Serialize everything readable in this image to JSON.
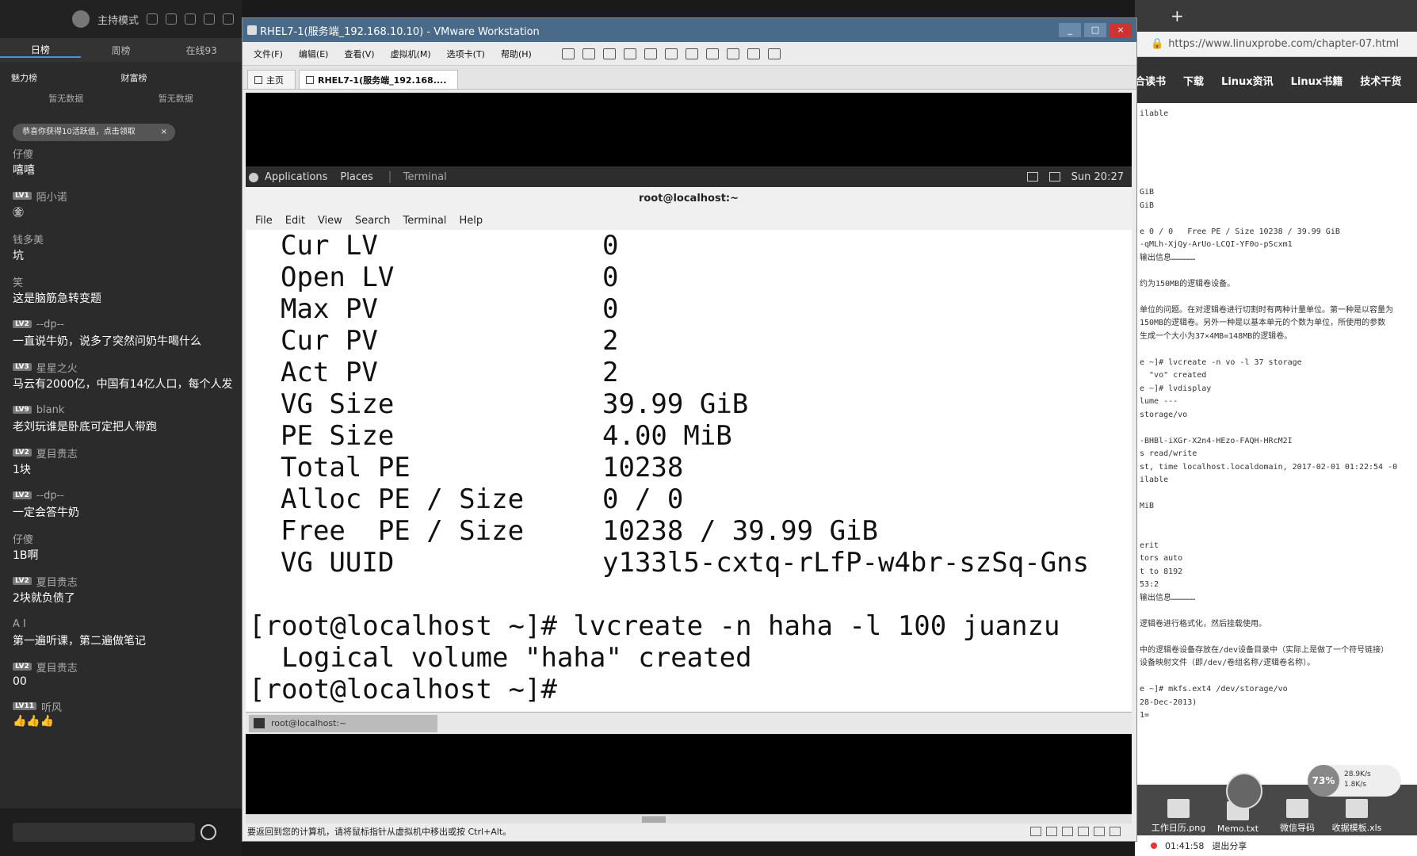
{
  "chat": {
    "host_mode": "主持模式",
    "tabs": [
      "日榜",
      "周榜",
      "在线93"
    ],
    "rank_left": "魅力榜",
    "rank_right": "财富榜",
    "rank_left_empty": "暂无数据",
    "rank_right_empty": "暂无数据",
    "notice": "恭喜你获得10活跃值，点击领取",
    "notice_close": "×",
    "messages": [
      {
        "level": "",
        "user": "仔傻",
        "text": "嘻嘻"
      },
      {
        "level": "LV1",
        "user": "陌小诺",
        "text": "㊎"
      },
      {
        "level": "",
        "user": "钱多美",
        "text": "坑"
      },
      {
        "level": "",
        "user": "笑",
        "text": "这是脑筋急转变题"
      },
      {
        "level": "LV2",
        "user": "--dp--",
        "text": "一直说牛奶，说多了突然问奶牛喝什么"
      },
      {
        "level": "LV3",
        "user": "星星之火",
        "text": "马云有2000亿，中国有14亿人口，每个人发"
      },
      {
        "level": "LV9",
        "user": "blank",
        "text": "老刘玩谁是卧底可定把人带跑"
      },
      {
        "level": "LV2",
        "user": "夏目贵志",
        "text": "1块"
      },
      {
        "level": "LV2",
        "user": "--dp--",
        "text": "一定会答牛奶"
      },
      {
        "level": "",
        "user": "仔傻",
        "text": "1B啊"
      },
      {
        "level": "LV2",
        "user": "夏目贵志",
        "text": "2块就负债了"
      },
      {
        "level": "",
        "user": "A  I",
        "text": "第一遍听课，第二遍做笔记"
      },
      {
        "level": "LV2",
        "user": "夏目贵志",
        "text": "00"
      },
      {
        "level": "LV11",
        "user": "听风",
        "text": "👍👍👍"
      }
    ]
  },
  "vmware": {
    "title": "RHEL7-1(服务端_192.168.10.10) - VMware Workstation",
    "menu": [
      "文件(F)",
      "编辑(E)",
      "查看(V)",
      "虚拟机(M)",
      "选项卡(T)",
      "帮助(H)"
    ],
    "tabs": [
      "主页",
      "RHEL7-1(服务端_192.168...."
    ],
    "status": "要返回到您的计算机，请将鼠标指针从虚拟机中移出或按 Ctrl+Alt。"
  },
  "gnome": {
    "applications": "Applications",
    "places": "Places",
    "terminal": "Terminal",
    "clock": "Sun 20:27",
    "task_label": "root@localhost:~"
  },
  "terminal": {
    "title": "root@localhost:~",
    "menu": [
      "File",
      "Edit",
      "View",
      "Search",
      "Terminal",
      "Help"
    ],
    "vg_rows": [
      {
        "k": "Cur LV",
        "v": "0"
      },
      {
        "k": "Open LV",
        "v": "0"
      },
      {
        "k": "Max PV",
        "v": "0"
      },
      {
        "k": "Cur PV",
        "v": "2"
      },
      {
        "k": "Act PV",
        "v": "2"
      },
      {
        "k": "VG Size",
        "v": "39.99 GiB"
      },
      {
        "k": "PE Size",
        "v": "4.00 MiB"
      },
      {
        "k": "Total PE",
        "v": "10238"
      },
      {
        "k": "Alloc PE / Size",
        "v": "0 / 0"
      },
      {
        "k": "Free  PE / Size",
        "v": "10238 / 39.99 GiB"
      },
      {
        "k": "VG UUID",
        "v": "y133l5-cxtq-rLfP-w4br-szSq-Gns"
      }
    ],
    "command": "[root@localhost ~]# lvcreate -n haha -l 100 juanzu",
    "output": "  Logical volume \"haha\" created",
    "prompt": "[root@localhost ~]# "
  },
  "browser": {
    "new_tab": "+",
    "url": "https://www.linuxprobe.com/chapter-07.html",
    "nav": [
      "合读书",
      "下载",
      "Linux资讯",
      "Linux书籍",
      "技术干货"
    ],
    "content_lines": [
      "ilable",
      "",
      "",
      "",
      "",
      "",
      "GiB",
      "GiB",
      "",
      "e 0 / 0   Free PE / Size 10238 / 39.99 GiB",
      "-qMLh-XjQy-ArUo-LCQI-YF0o-pScxm1",
      "输出信息……………",
      "",
      "约为150MB的逻辑卷设备。",
      "",
      "单位的问题。在对逻辑卷进行切割时有两种计量单位。第一种是以容量为",
      "150MB的逻辑卷。另外一种是以基本单元的个数为单位，所使用的参数",
      "生成一个大小为37×4MB=148MB的逻辑卷。",
      "",
      "e ~]# lvcreate -n vo -l 37 storage",
      "  \"vo\" created",
      "e ~]# lvdisplay",
      "lume ---",
      "storage/vo",
      "",
      "-BHBl-iXGr-X2n4-HEzo-FAQH-HRcM2I",
      "s read/write",
      "st, time localhost.localdomain, 2017-02-01 01:22:54 -0",
      "ilable",
      "",
      "MiB",
      "",
      "",
      "erit",
      "tors auto",
      "t to 8192",
      "53:2",
      "输出信息……………",
      "",
      "逻辑卷进行格式化，然后挂载使用。",
      "",
      "中的逻辑卷设备存放在/dev设备目录中（实际上是做了一个符号链接）",
      "设备映射文件（即/dev/卷组名称/逻辑卷名称）。",
      "",
      "e ~]# mkfs.ext4 /dev/storage/vo",
      "28-Dec-2013)",
      "1="
    ],
    "speed_pct": "73%",
    "speed_up": "28.9K/s",
    "speed_down": "1.8K/s",
    "desktop_items": [
      "工作日历.png",
      "Memo.txt",
      "微信导码",
      "收据模板.xls"
    ],
    "timer": "01:41:58",
    "exit_share": "退出分享"
  }
}
